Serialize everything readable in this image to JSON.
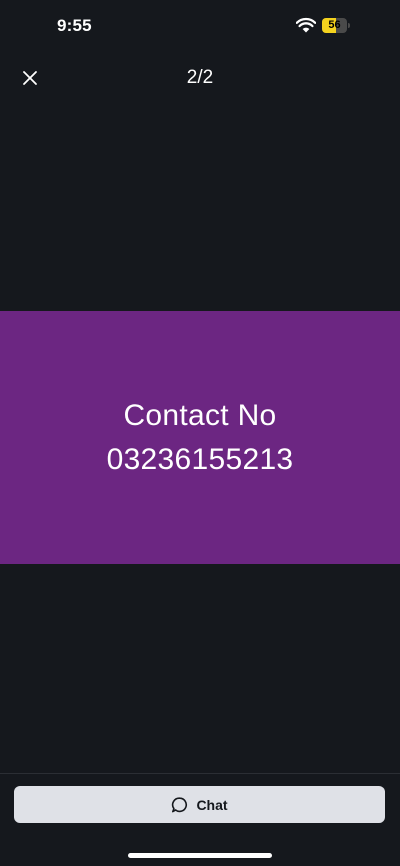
{
  "status_bar": {
    "time": "9:55",
    "battery_level": "56",
    "battery_fraction": 0.56,
    "battery_color": "#f4d21e"
  },
  "nav": {
    "close_icon": "close-icon",
    "page_counter": "2/2"
  },
  "photo": {
    "background_color": "#6c2682",
    "lines": [
      "Contact No",
      "03236155213"
    ]
  },
  "bottom_bar": {
    "chat_icon": "chat-bubble-icon",
    "chat_label": "Chat"
  }
}
